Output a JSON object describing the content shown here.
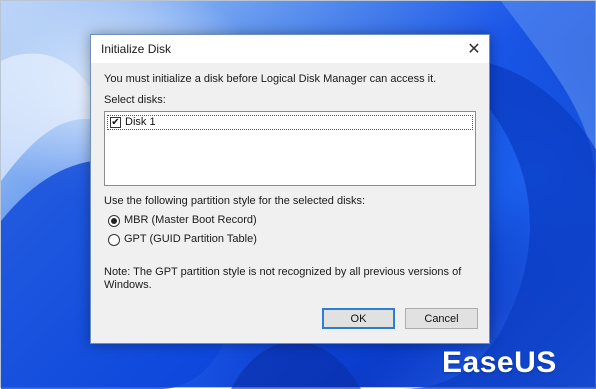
{
  "dialog": {
    "title": "Initialize Disk",
    "close_glyph": "✕",
    "intro": "You must initialize a disk before Logical Disk Manager can access it.",
    "select_label": "Select disks:",
    "disks": [
      {
        "label": "Disk 1",
        "checked": true,
        "check_glyph": "✔"
      }
    ],
    "partition_label": "Use the following partition style for the selected disks:",
    "options": [
      {
        "label": "MBR (Master Boot Record)",
        "selected": true
      },
      {
        "label": "GPT (GUID Partition Table)",
        "selected": false
      }
    ],
    "note_line1": "Note: The GPT partition style is not recognized by all previous versions of",
    "note_line2": "Windows.",
    "ok_label": "OK",
    "cancel_label": "Cancel"
  },
  "watermark": {
    "text": "EaseUS"
  },
  "colors": {
    "accent": "#2a7fd4",
    "wallpaper_blue": "#1a56e8"
  }
}
